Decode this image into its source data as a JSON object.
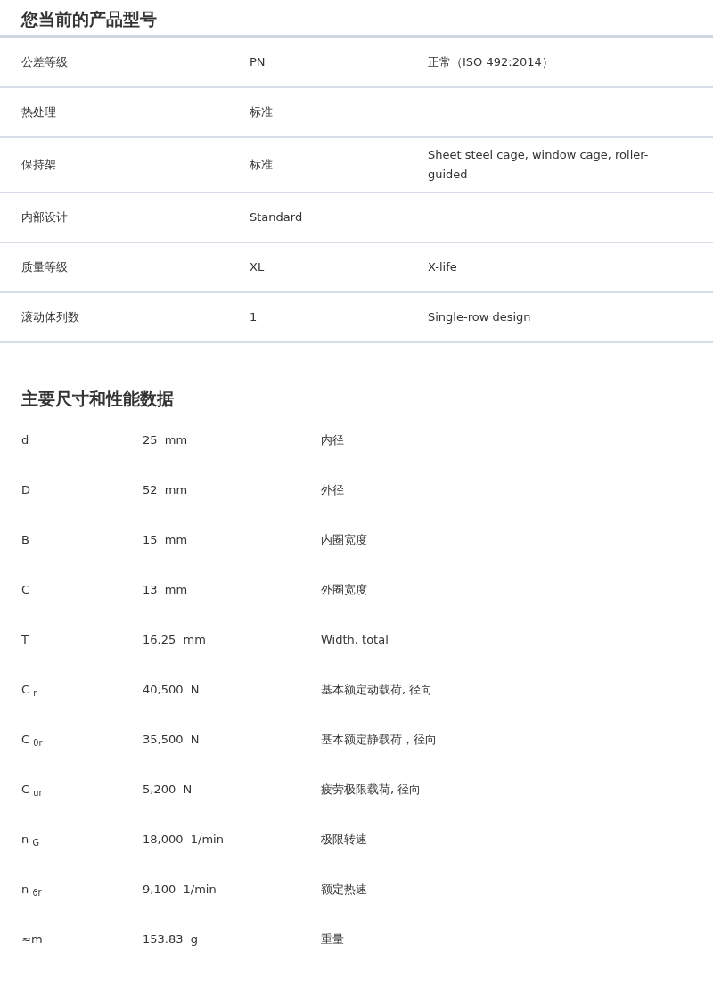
{
  "product_section": {
    "title": "您当前的产品型号",
    "rows": [
      {
        "label": "公差等级",
        "value": "PN",
        "description": "正常（ISO 492:2014）"
      },
      {
        "label": "热处理",
        "value": "标准"
      },
      {
        "label": "保持架",
        "value": "标准",
        "description": "Sheet steel cage, window cage, roller-guided"
      },
      {
        "label": "内部设计",
        "value": "Standard"
      },
      {
        "label": "质量等级",
        "value": "XL",
        "description": "X-life"
      },
      {
        "label": "滚动体列数",
        "value": "1",
        "description": "Single-row design"
      }
    ]
  },
  "dimensions_section": {
    "title": "主要尺寸和性能数据",
    "rows": [
      {
        "symbol": "d",
        "value": "25",
        "unit": "mm",
        "description": "内径"
      },
      {
        "symbol": "D",
        "value": "52",
        "unit": "mm",
        "description": "外径"
      },
      {
        "symbol": "B",
        "value": "15",
        "unit": "mm",
        "description": "内圈宽度"
      },
      {
        "symbol": "C",
        "value": "13",
        "unit": "mm",
        "description": "外圈宽度"
      },
      {
        "symbol": "T",
        "value": "16.25",
        "unit": "mm",
        "description": "Width, total"
      },
      {
        "symbol": "C $_{r}$",
        "value": "40,500",
        "unit": "N",
        "description": "基本额定动载荷, 径向"
      },
      {
        "symbol": "C $_{0r}$",
        "value": "35,500",
        "unit": "N",
        "description": "基本额定静载荷，径向"
      },
      {
        "symbol": "C $_{ur}$",
        "value": "5,200",
        "unit": "N",
        "description": "疲劳极限载荷, 径向"
      },
      {
        "symbol": "n $_{G}$",
        "value": "18,000",
        "unit": "1/min",
        "description": "极限转速"
      },
      {
        "symbol": "n $_{ϑr}$",
        "value": "9,100",
        "unit": "1/min",
        "description": "额定热速"
      },
      {
        "symbol": "≈m",
        "value": "153.83",
        "unit": "g",
        "description": "重量"
      }
    ]
  }
}
